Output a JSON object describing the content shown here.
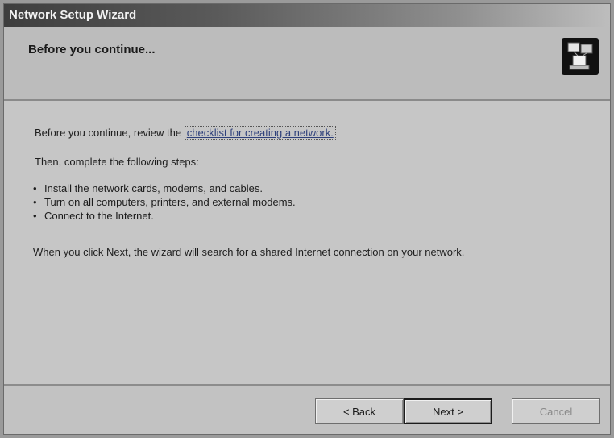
{
  "window": {
    "title": "Network Setup Wizard"
  },
  "header": {
    "title": "Before you continue..."
  },
  "content": {
    "intro_prefix": "Before you continue, review the ",
    "intro_link": "checklist for creating a network.",
    "then_text": "Then, complete the following steps:",
    "steps": [
      "Install the network cards, modems, and cables.",
      "Turn on all computers, printers, and external modems.",
      "Connect to the Internet."
    ],
    "next_info": "When you click Next, the wizard will search for a shared Internet connection on your network."
  },
  "buttons": {
    "back": "< Back",
    "next": "Next >",
    "cancel": "Cancel"
  }
}
